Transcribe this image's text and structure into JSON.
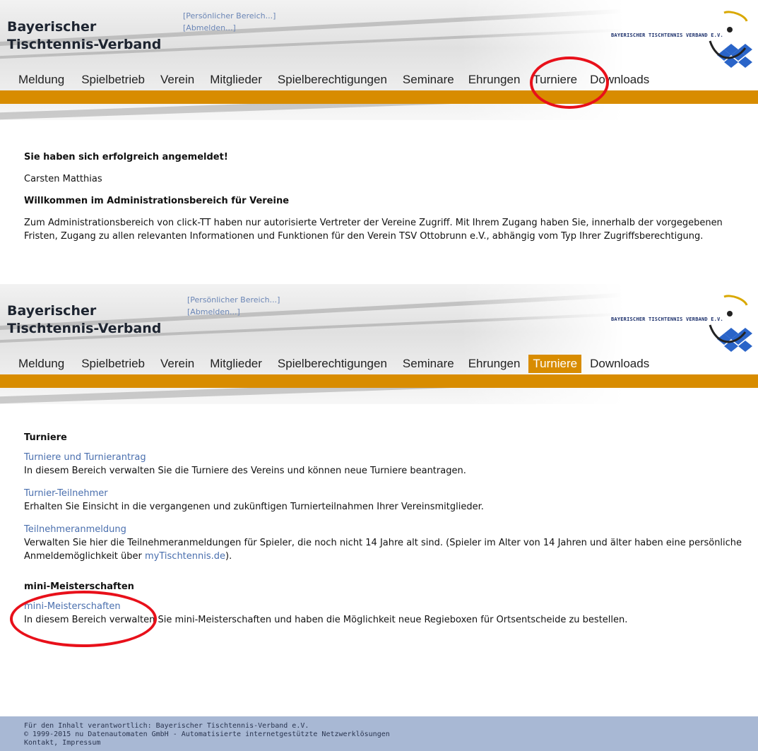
{
  "header": {
    "brand_line1": "Bayerischer",
    "brand_line2": "Tischtennis-Verband",
    "personal_area": "[Persönlicher Bereich...]",
    "logout": "[Abmelden...]",
    "logo_text": "BAYERISCHER TISCHTENNIS VERBAND E.V."
  },
  "nav": {
    "items": [
      {
        "label": "Meldung"
      },
      {
        "label": "Spielbetrieb"
      },
      {
        "label": "Verein"
      },
      {
        "label": "Mitglieder"
      },
      {
        "label": "Spielberechtigungen"
      },
      {
        "label": "Seminare"
      },
      {
        "label": "Ehrungen"
      },
      {
        "label": "Turniere"
      },
      {
        "label": "Downloads"
      }
    ],
    "active_bottom": "Turniere"
  },
  "top_content": {
    "login_success": "Sie haben sich erfolgreich angemeldet!",
    "user_name": "Carsten Matthias",
    "welcome_heading": "Willkommen im Administrationsbereich für Vereine",
    "welcome_text": "Zum Administrationsbereich von click-TT haben nur autorisierte Vertreter der Vereine Zugriff. Mit Ihrem Zugang haben Sie, innerhalb der vorgegebenen Fristen, Zugang zu allen relevanten Informationen und Funktionen für den Verein TSV Ottobrunn e.V., abhängig vom Typ Ihrer Zugriffsberechtigung."
  },
  "bottom_content": {
    "turniere_heading": "Turniere",
    "link1": "Turniere und Turnierantrag",
    "desc1": "In diesem Bereich verwalten Sie die Turniere des Vereins und können neue Turniere beantragen.",
    "link2": "Turnier-Teilnehmer",
    "desc2": "Erhalten Sie Einsicht in die vergangenen und zukünftigen Turnierteilnahmen Ihrer Vereinsmitglieder.",
    "link3": "Teilnehmeranmeldung",
    "desc3_part1": "Verwalten Sie hier die Teilnehmeranmeldungen für Spieler, die noch nicht 14 Jahre alt sind. (Spieler im Alter von 14 Jahren und älter haben eine persönliche Anmeldemöglichkeit über ",
    "desc3_link": "myTischtennis.de",
    "desc3_part2": ").",
    "mini_heading": "mini-Meisterschaften",
    "link4": "mini-Meisterschaften",
    "desc4": "In diesem Bereich verwalten Sie mini-Meisterschaften und haben die Möglichkeit neue Regieboxen für Ortsentscheide zu bestellen."
  },
  "footer": {
    "line1": "Für den Inhalt verantwortlich: Bayerischer Tischtennis-Verband e.V.",
    "line2": "© 1999-2015 nu Datenautomaten GmbH - Automatisierte internetgestützte Netzwerklösungen",
    "line3": "Kontakt, Impressum"
  },
  "colors": {
    "accent_orange": "#d88c00",
    "link_blue": "#4a6fae",
    "highlight_red": "#e8101a",
    "footer_bg": "#a8b8d4"
  }
}
